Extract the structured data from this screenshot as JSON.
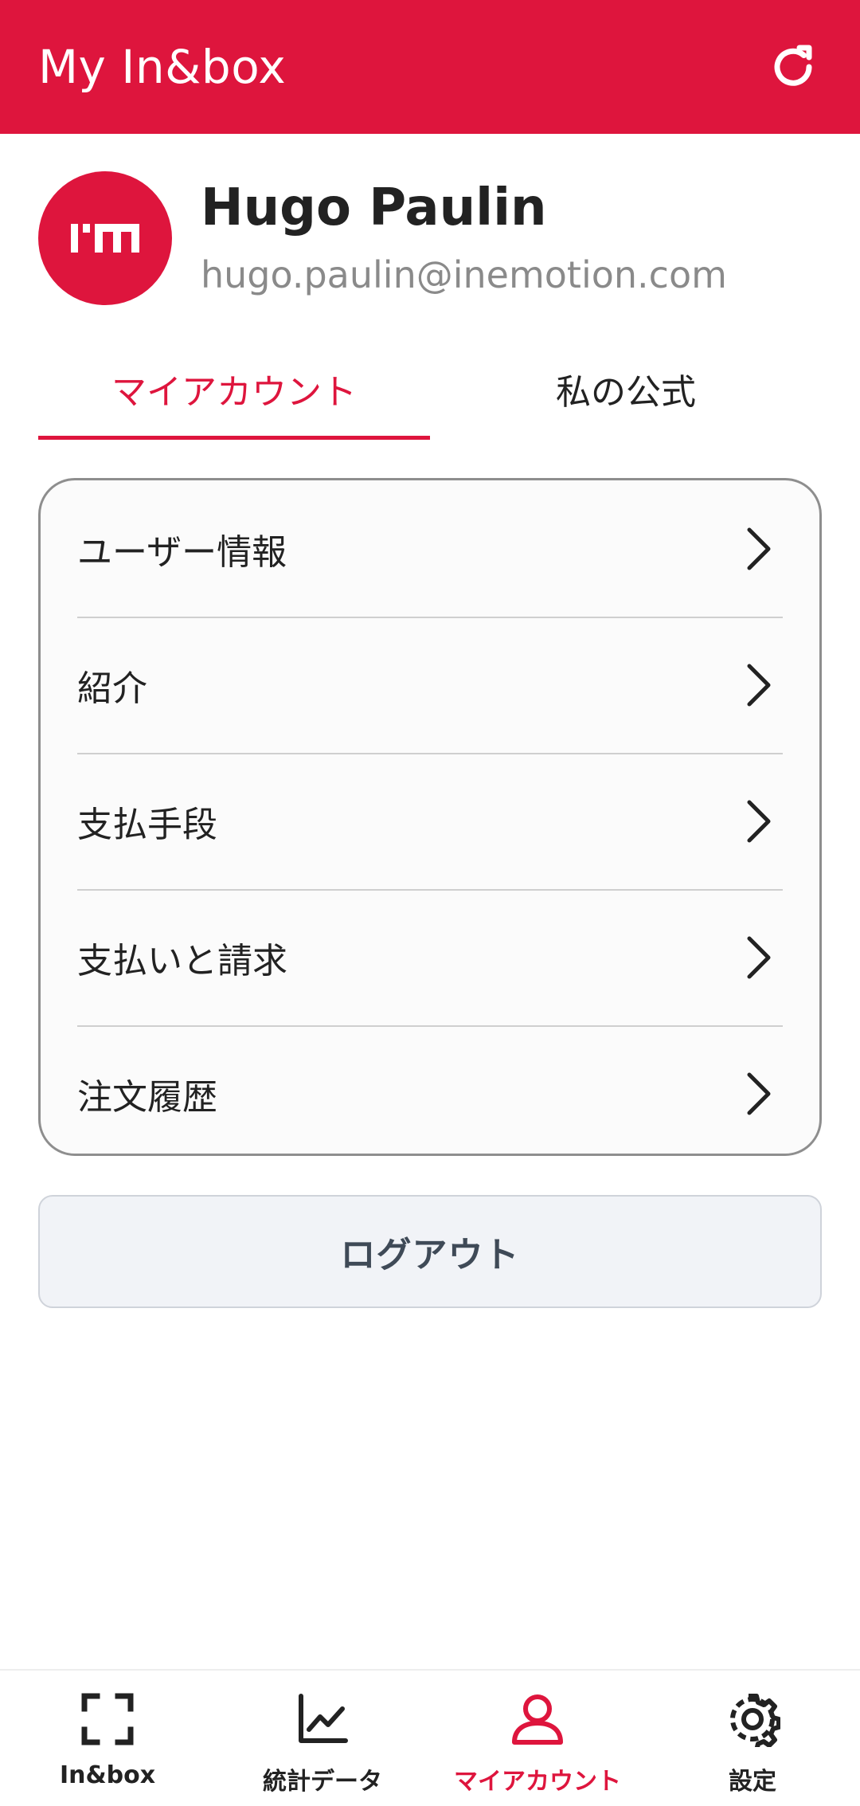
{
  "header": {
    "title": "My In&box",
    "refresh_icon": "refresh-icon"
  },
  "profile": {
    "avatar_icon": "im-logo-icon",
    "name": "Hugo Paulin",
    "email": "hugo.paulin@inemotion.com"
  },
  "tabs": [
    {
      "label": "マイアカウント",
      "active": true
    },
    {
      "label": "私の公式",
      "active": false
    }
  ],
  "menu": {
    "items": [
      {
        "label": "ユーザー情報"
      },
      {
        "label": "紹介"
      },
      {
        "label": "支払手段"
      },
      {
        "label": "支払いと請求"
      },
      {
        "label": "注文履歴"
      }
    ]
  },
  "logout": {
    "label": "ログアウト"
  },
  "bottom_nav": {
    "items": [
      {
        "label": "In&box",
        "icon": "scan-frame-icon",
        "active": false
      },
      {
        "label": "統計データ",
        "icon": "chart-icon",
        "active": false
      },
      {
        "label": "マイアカウント",
        "icon": "user-icon",
        "active": true
      },
      {
        "label": "設定",
        "icon": "gear-icon",
        "active": false
      }
    ]
  },
  "colors": {
    "brand": "#DE153D",
    "text": "#222222",
    "muted": "#8A8A8A"
  }
}
